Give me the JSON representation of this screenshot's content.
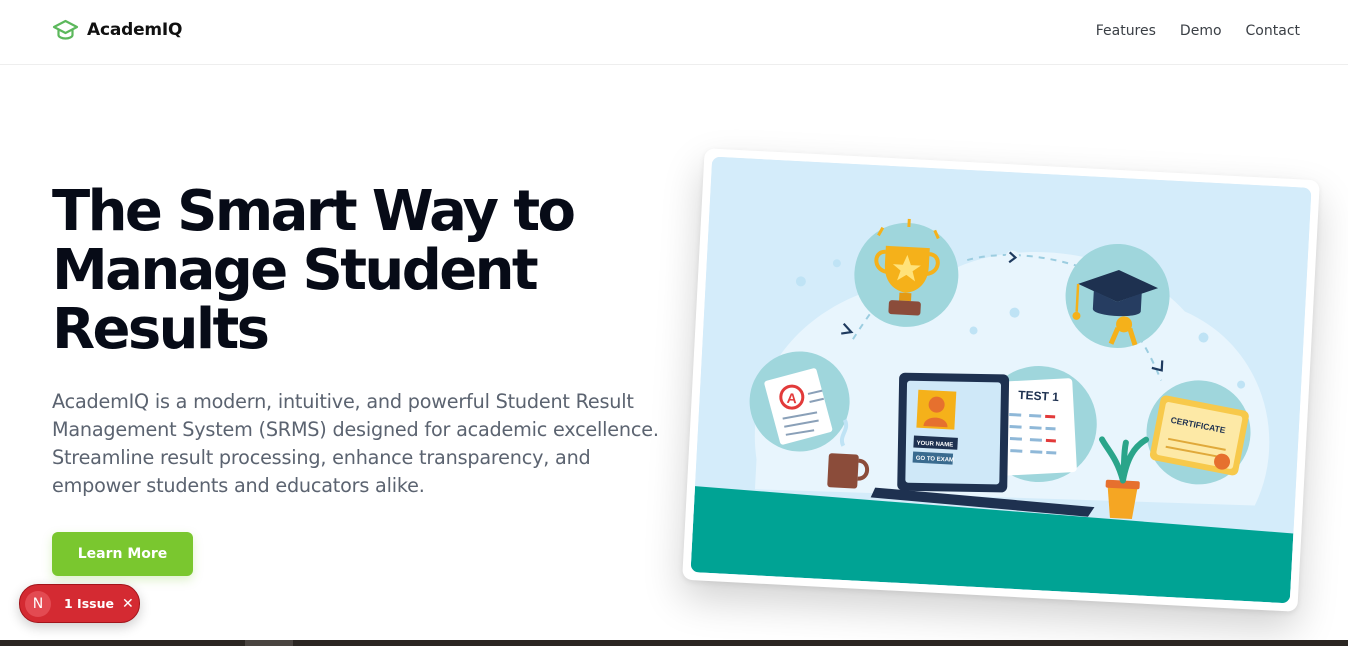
{
  "header": {
    "brand": "AcademIQ",
    "nav": [
      {
        "label": "Features"
      },
      {
        "label": "Demo"
      },
      {
        "label": "Contact"
      }
    ]
  },
  "hero": {
    "title": "The Smart Way to Manage Student Results",
    "description": "AcademIQ is a modern, intuitive, and powerful Student Result Management System (SRMS) designed for academic excellence. Streamline result processing, enhance transparency, and empower students and educators alike.",
    "cta_label": "Learn More"
  },
  "illustration": {
    "test_label": "TEST 1",
    "certificate_label": "CERTIFICATE",
    "name_label": "YOUR NAME",
    "exam_label": "GO TO EXAM",
    "grade_letter": "A"
  },
  "issue_badge": {
    "avatar_letter": "N",
    "label": "1 Issue",
    "close": "✕"
  },
  "colors": {
    "brand": "#7ac72f",
    "title": "#070b17",
    "body_text": "#5b6370",
    "issue_badge": "#d42a32",
    "illustration_bg": "#cfe8f8",
    "desk": "#00a394"
  }
}
